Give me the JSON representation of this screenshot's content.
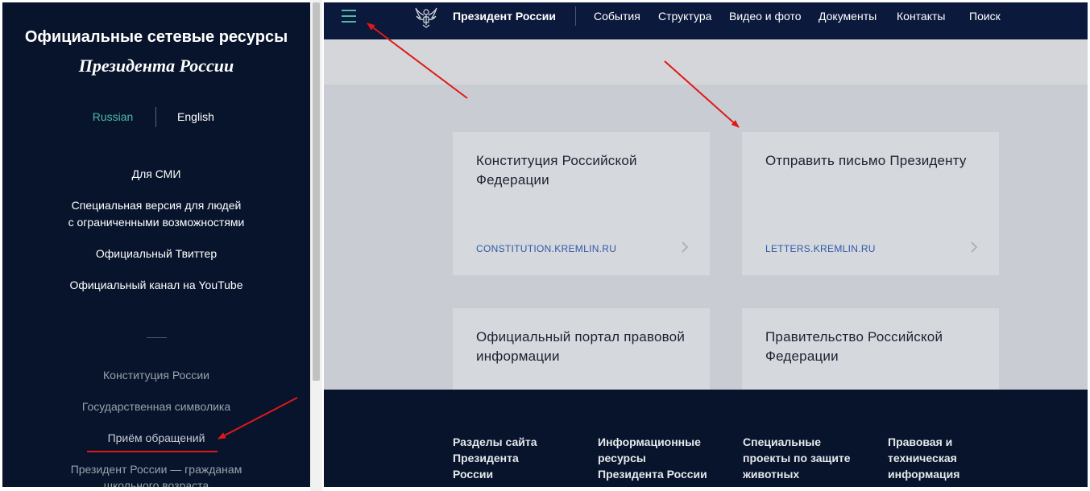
{
  "sidebar": {
    "title_line1": "Официальные сетевые ресурсы",
    "title_line2": "Президента России",
    "languages": {
      "active": "Russian",
      "other": "English"
    },
    "links": [
      "Для СМИ",
      "Специальная версия для людей\nс ограниченными возможностями",
      "Официальный Твиттер",
      "Официальный канал на YouTube"
    ],
    "secondary_links": [
      "Конституция России",
      "Государственная символика",
      "Приём обращений",
      "Президент России — гражданам\nшкольного возраста"
    ]
  },
  "header": {
    "brand": "Президент России",
    "nav": [
      "События",
      "Структура",
      "Видео и фото",
      "Документы",
      "Контакты",
      "Поиск"
    ]
  },
  "cards": [
    {
      "title": "Конституция Российской Федерации",
      "link": "CONSTITUTION.KREMLIN.RU"
    },
    {
      "title": "Отправить письмо Президенту",
      "link": "LETTERS.KREMLIN.RU"
    },
    {
      "title": "Официальный портал правовой информации",
      "link": ""
    },
    {
      "title": "Правительство Российской Федерации",
      "link": ""
    }
  ],
  "footer": {
    "columns": [
      "Разделы сайта\nПрезидента\nРоссии",
      "Информационные\nресурсы\nПрезидента России",
      "Специальные\nпроекты по защите\nживотных",
      "Правовая и\nтехническая\nинформация"
    ]
  },
  "colors": {
    "sidebar_bg": "#07142c",
    "header_bg": "#0b1a3c",
    "accent": "#4fb8a6",
    "link": "#2f5aa8",
    "annotation": "#e01818"
  },
  "icons": [
    "hamburger-menu-icon",
    "coat-of-arms-icon",
    "chevron-right-icon"
  ]
}
